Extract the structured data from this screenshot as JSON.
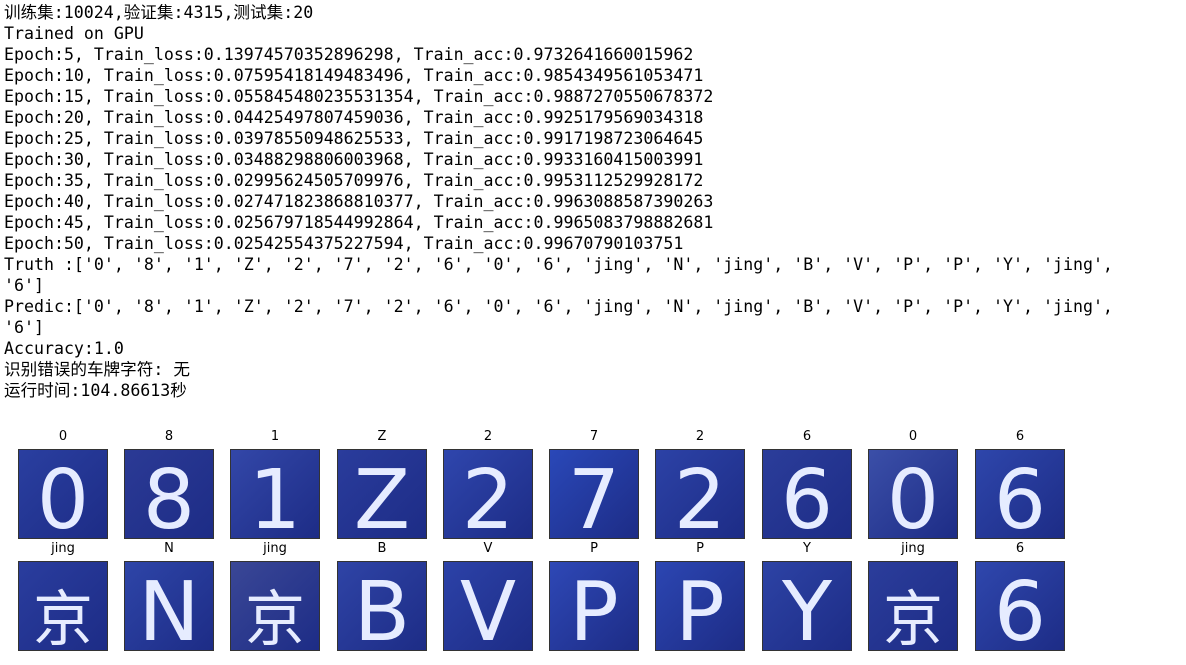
{
  "console": {
    "lines": [
      "训练集:10024,验证集:4315,测试集:20",
      "Trained on GPU",
      "Epoch:5, Train_loss:0.13974570352896298, Train_acc:0.9732641660015962",
      "Epoch:10, Train_loss:0.07595418149483496, Train_acc:0.9854349561053471",
      "Epoch:15, Train_loss:0.055845480235531354, Train_acc:0.9887270550678372",
      "Epoch:20, Train_loss:0.04425497807459036, Train_acc:0.9925179569034318",
      "Epoch:25, Train_loss:0.03978550948625533, Train_acc:0.9917198723064645",
      "Epoch:30, Train_loss:0.03488298806003968, Train_acc:0.9933160415003991",
      "Epoch:35, Train_loss:0.02995624505709976, Train_acc:0.9953112529928172",
      "Epoch:40, Train_loss:0.027471823868810377, Train_acc:0.9963088587390263",
      "Epoch:45, Train_loss:0.025679718544992864, Train_acc:0.9965083798882681",
      "Epoch:50, Train_loss:0.02542554375227594, Train_acc:0.99670790103751",
      "Truth :['0', '8', '1', 'Z', '2', '7', '2', '6', '0', '6', 'jing', 'N', 'jing', 'B', 'V', 'P', 'P', 'Y', 'jing',",
      "'6']",
      "Predic:['0', '8', '1', 'Z', '2', '7', '2', '6', '0', '6', 'jing', 'N', 'jing', 'B', 'V', 'P', 'P', 'Y', 'jing',",
      "'6']",
      "Accuracy:1.0",
      "识别错误的车牌字符: 无",
      "运行时间:104.86613秒"
    ]
  },
  "figure": {
    "rows": [
      [
        {
          "title": "0",
          "glyph": "0",
          "tone": "#2a3fa0"
        },
        {
          "title": "8",
          "glyph": "8",
          "tone": "#2b3a95"
        },
        {
          "title": "1",
          "glyph": "1",
          "tone": "#3347a8"
        },
        {
          "title": "Z",
          "glyph": "Z",
          "tone": "#2a3c9c"
        },
        {
          "title": "2",
          "glyph": "2",
          "tone": "#2f46ad"
        },
        {
          "title": "7",
          "glyph": "7",
          "tone": "#2a48b8"
        },
        {
          "title": "2",
          "glyph": "2",
          "tone": "#2c42a6"
        },
        {
          "title": "6",
          "glyph": "6",
          "tone": "#2b3d9a"
        },
        {
          "title": "0",
          "glyph": "0",
          "tone": "#3b4fa8"
        },
        {
          "title": "6",
          "glyph": "6",
          "tone": "#2e46ab"
        }
      ],
      [
        {
          "title": "jing",
          "glyph": "京",
          "tone": "#2a3d9e"
        },
        {
          "title": "N",
          "glyph": "N",
          "tone": "#2e45a8"
        },
        {
          "title": "jing",
          "glyph": "京",
          "tone": "#3a4796"
        },
        {
          "title": "B",
          "glyph": "B",
          "tone": "#2f44a6"
        },
        {
          "title": "V",
          "glyph": "V",
          "tone": "#2c42a8"
        },
        {
          "title": "P",
          "glyph": "P",
          "tone": "#2e48b6"
        },
        {
          "title": "P",
          "glyph": "P",
          "tone": "#2c46b2"
        },
        {
          "title": "Y",
          "glyph": "Y",
          "tone": "#2d43a5"
        },
        {
          "title": "jing",
          "glyph": "京",
          "tone": "#2b3d9b"
        },
        {
          "title": "6",
          "glyph": "6",
          "tone": "#2f47ad"
        }
      ]
    ]
  }
}
